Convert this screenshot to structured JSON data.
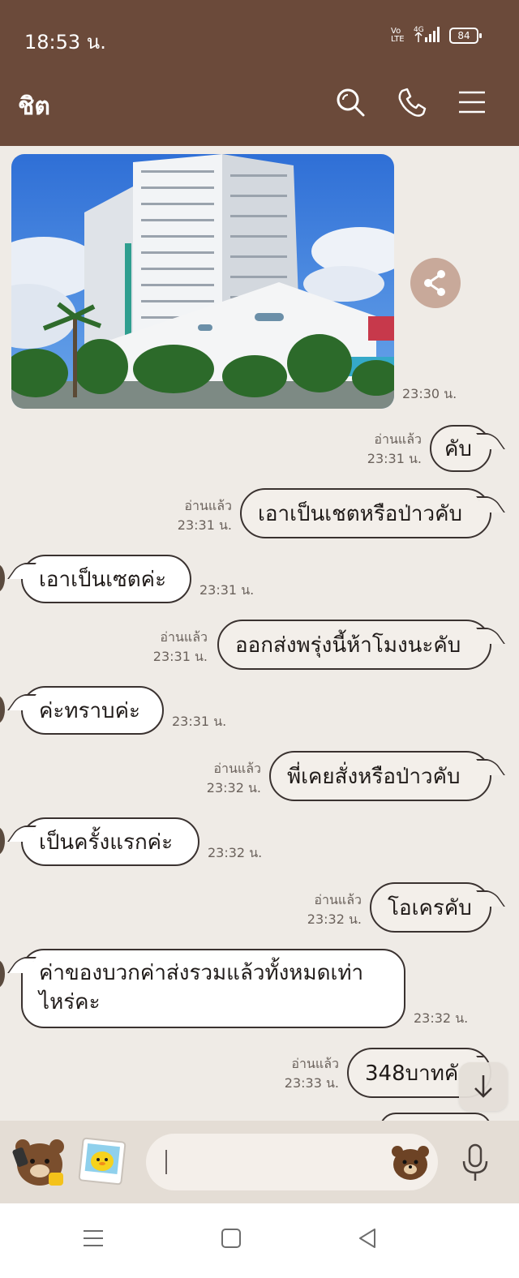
{
  "status_bar": {
    "time": "18:53 น.",
    "network_volte": "Vo LTE",
    "network_type": "4G",
    "battery": "84"
  },
  "header": {
    "title": "ชิต",
    "icons": [
      "search-icon",
      "phone-icon",
      "menu-icon"
    ],
    "bg_color": "#6b4a3a"
  },
  "messages": [
    {
      "side": "in",
      "type": "image",
      "alt": "",
      "time": "23:30 น."
    },
    {
      "side": "out",
      "text": "คับ",
      "read": "อ่านแล้ว",
      "time": "23:31 น."
    },
    {
      "side": "out",
      "text": "เอาเป็นเชตหรือป่าวคับ",
      "read": "อ่านแล้ว",
      "time": "23:31 น."
    },
    {
      "side": "in",
      "text": "เอาเป็นเซตค่ะ",
      "time": "23:31 น."
    },
    {
      "side": "out",
      "text": "ออกส่งพรุ่งนี้ห้าโมงนะคับ",
      "read": "อ่านแล้ว",
      "time": "23:31 น."
    },
    {
      "side": "in",
      "text": "ค่ะทราบค่ะ",
      "time": "23:31 น."
    },
    {
      "side": "out",
      "text": "พี่เคยสั่งหรือป่าวคับ",
      "read": "อ่านแล้ว",
      "time": "23:32 น."
    },
    {
      "side": "in",
      "text": "เป็นครั้งแรกค่ะ",
      "time": "23:32 น."
    },
    {
      "side": "out",
      "text": "โอเครคับ",
      "read": "อ่านแล้ว",
      "time": "23:32 น."
    },
    {
      "side": "in",
      "text": "ค่าของบวกค่าส่งรวมแล้วทั้งหมดเท่าไหร่คะ",
      "time": "23:32 น."
    },
    {
      "side": "out",
      "text": "348บาทคั",
      "read": "อ่านแล้ว",
      "time": "23:33 น."
    }
  ],
  "input": {
    "placeholder": "",
    "icons": [
      "bear-sticker-icon",
      "photo-sticker-icon",
      "bear-emoji-icon",
      "microphone-icon"
    ]
  },
  "nav": {
    "icons": [
      "recents-icon",
      "home-icon",
      "back-icon"
    ]
  },
  "colors": {
    "accent": "#6b4a3a",
    "chat_bg": "#efebe6",
    "share": "#c8a99a"
  }
}
